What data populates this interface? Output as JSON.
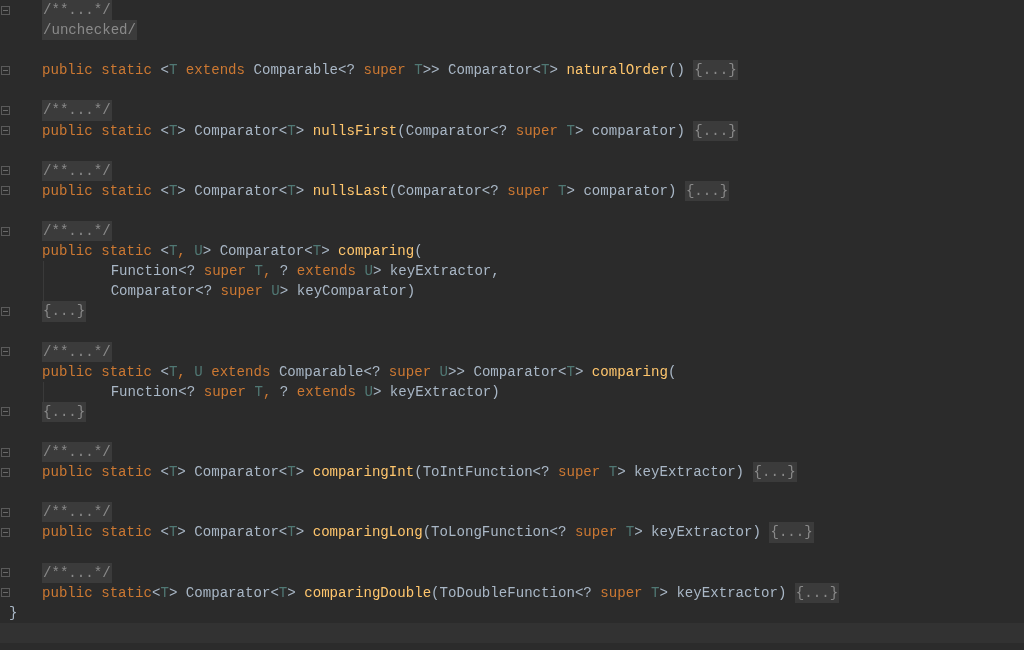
{
  "editor": {
    "lines": [
      {
        "kind": "code",
        "fold_marker": true,
        "tokens": [
          {
            "text": "/**...*/",
            "kind": "folded"
          }
        ]
      },
      {
        "kind": "code",
        "fold_marker": false,
        "tokens": [
          {
            "text": "/unchecked/",
            "kind": "folded"
          }
        ]
      },
      {
        "kind": "blank",
        "fold_marker": false
      },
      {
        "kind": "code",
        "fold_marker": true,
        "tokens": [
          {
            "text": "public static ",
            "kind": "keyword"
          },
          {
            "text": "<",
            "kind": "plain"
          },
          {
            "text": "T",
            "kind": "type_param"
          },
          {
            "text": " extends ",
            "kind": "keyword"
          },
          {
            "text": "Comparable<? ",
            "kind": "plain"
          },
          {
            "text": "super ",
            "kind": "keyword"
          },
          {
            "text": "T",
            "kind": "type_param"
          },
          {
            "text": ">> Comparator<",
            "kind": "plain"
          },
          {
            "text": "T",
            "kind": "type_param"
          },
          {
            "text": "> ",
            "kind": "plain"
          },
          {
            "text": "naturalOrder",
            "kind": "method"
          },
          {
            "text": "()",
            "kind": "plain"
          },
          {
            "text": "{...}",
            "kind": "folded"
          }
        ]
      },
      {
        "kind": "blank",
        "fold_marker": false
      },
      {
        "kind": "code",
        "fold_marker": true,
        "tokens": [
          {
            "text": "/**...*/",
            "kind": "folded"
          }
        ]
      },
      {
        "kind": "code",
        "fold_marker": true,
        "tokens": [
          {
            "text": "public static ",
            "kind": "keyword"
          },
          {
            "text": "<",
            "kind": "plain"
          },
          {
            "text": "T",
            "kind": "type_param"
          },
          {
            "text": "> Comparator<",
            "kind": "plain"
          },
          {
            "text": "T",
            "kind": "type_param"
          },
          {
            "text": "> ",
            "kind": "plain"
          },
          {
            "text": "nullsFirst",
            "kind": "method"
          },
          {
            "text": "(Comparator<? ",
            "kind": "plain"
          },
          {
            "text": "super ",
            "kind": "keyword"
          },
          {
            "text": "T",
            "kind": "type_param"
          },
          {
            "text": "> comparator)",
            "kind": "plain"
          },
          {
            "text": "{...}",
            "kind": "folded"
          }
        ]
      },
      {
        "kind": "blank",
        "fold_marker": false
      },
      {
        "kind": "code",
        "fold_marker": true,
        "tokens": [
          {
            "text": "/**...*/",
            "kind": "folded"
          }
        ]
      },
      {
        "kind": "code",
        "fold_marker": true,
        "tokens": [
          {
            "text": "public static ",
            "kind": "keyword"
          },
          {
            "text": "<",
            "kind": "plain"
          },
          {
            "text": "T",
            "kind": "type_param"
          },
          {
            "text": "> Comparator<",
            "kind": "plain"
          },
          {
            "text": "T",
            "kind": "type_param"
          },
          {
            "text": "> ",
            "kind": "plain"
          },
          {
            "text": "nullsLast",
            "kind": "method"
          },
          {
            "text": "(Comparator<? ",
            "kind": "plain"
          },
          {
            "text": "super ",
            "kind": "keyword"
          },
          {
            "text": "T",
            "kind": "type_param"
          },
          {
            "text": "> comparator)",
            "kind": "plain"
          },
          {
            "text": "{...}",
            "kind": "folded"
          }
        ]
      },
      {
        "kind": "blank",
        "fold_marker": false
      },
      {
        "kind": "code",
        "fold_marker": true,
        "tokens": [
          {
            "text": "/**...*/",
            "kind": "folded"
          }
        ]
      },
      {
        "kind": "code",
        "fold_marker": false,
        "tokens": [
          {
            "text": "public static ",
            "kind": "keyword"
          },
          {
            "text": "<",
            "kind": "plain"
          },
          {
            "text": "T",
            "kind": "type_param"
          },
          {
            "text": ", ",
            "kind": "keyword"
          },
          {
            "text": "U",
            "kind": "type_param"
          },
          {
            "text": "> Comparator<",
            "kind": "plain"
          },
          {
            "text": "T",
            "kind": "type_param"
          },
          {
            "text": "> ",
            "kind": "plain"
          },
          {
            "text": "comparing",
            "kind": "method"
          },
          {
            "text": "(",
            "kind": "plain"
          }
        ]
      },
      {
        "kind": "continuation",
        "fold_marker": false,
        "tokens": [
          {
            "text": "Function<? ",
            "kind": "plain"
          },
          {
            "text": "super ",
            "kind": "keyword"
          },
          {
            "text": "T",
            "kind": "type_param"
          },
          {
            "text": ", ",
            "kind": "keyword"
          },
          {
            "text": "? ",
            "kind": "plain"
          },
          {
            "text": "extends ",
            "kind": "keyword"
          },
          {
            "text": "U",
            "kind": "type_param"
          },
          {
            "text": "> keyExtractor,",
            "kind": "plain"
          }
        ]
      },
      {
        "kind": "continuation",
        "fold_marker": false,
        "tokens": [
          {
            "text": "Comparator<? ",
            "kind": "plain"
          },
          {
            "text": "super ",
            "kind": "keyword"
          },
          {
            "text": "U",
            "kind": "type_param"
          },
          {
            "text": "> keyComparator)",
            "kind": "plain"
          }
        ]
      },
      {
        "kind": "code",
        "fold_marker": true,
        "tokens": [
          {
            "text": "{...}",
            "kind": "folded"
          }
        ]
      },
      {
        "kind": "blank",
        "fold_marker": false
      },
      {
        "kind": "code",
        "fold_marker": true,
        "tokens": [
          {
            "text": "/**...*/",
            "kind": "folded"
          }
        ]
      },
      {
        "kind": "code",
        "fold_marker": false,
        "tokens": [
          {
            "text": "public static ",
            "kind": "keyword"
          },
          {
            "text": "<",
            "kind": "plain"
          },
          {
            "text": "T",
            "kind": "type_param"
          },
          {
            "text": ", ",
            "kind": "keyword"
          },
          {
            "text": "U",
            "kind": "type_param"
          },
          {
            "text": " extends ",
            "kind": "keyword"
          },
          {
            "text": "Comparable<? ",
            "kind": "plain"
          },
          {
            "text": "super ",
            "kind": "keyword"
          },
          {
            "text": "U",
            "kind": "type_param"
          },
          {
            "text": ">> Comparator<",
            "kind": "plain"
          },
          {
            "text": "T",
            "kind": "type_param"
          },
          {
            "text": "> ",
            "kind": "plain"
          },
          {
            "text": "comparing",
            "kind": "method"
          },
          {
            "text": "(",
            "kind": "plain"
          }
        ]
      },
      {
        "kind": "continuation",
        "fold_marker": false,
        "tokens": [
          {
            "text": "Function<? ",
            "kind": "plain"
          },
          {
            "text": "super ",
            "kind": "keyword"
          },
          {
            "text": "T",
            "kind": "type_param"
          },
          {
            "text": ", ",
            "kind": "keyword"
          },
          {
            "text": "? ",
            "kind": "plain"
          },
          {
            "text": "extends ",
            "kind": "keyword"
          },
          {
            "text": "U",
            "kind": "type_param"
          },
          {
            "text": "> keyExtractor)",
            "kind": "plain"
          }
        ]
      },
      {
        "kind": "code",
        "fold_marker": true,
        "tokens": [
          {
            "text": "{...}",
            "kind": "folded"
          }
        ]
      },
      {
        "kind": "blank",
        "fold_marker": false
      },
      {
        "kind": "code",
        "fold_marker": true,
        "tokens": [
          {
            "text": "/**...*/",
            "kind": "folded"
          }
        ]
      },
      {
        "kind": "code",
        "fold_marker": true,
        "tokens": [
          {
            "text": "public static ",
            "kind": "keyword"
          },
          {
            "text": "<",
            "kind": "plain"
          },
          {
            "text": "T",
            "kind": "type_param"
          },
          {
            "text": "> Comparator<",
            "kind": "plain"
          },
          {
            "text": "T",
            "kind": "type_param"
          },
          {
            "text": "> ",
            "kind": "plain"
          },
          {
            "text": "comparingInt",
            "kind": "method"
          },
          {
            "text": "(ToIntFunction<? ",
            "kind": "plain"
          },
          {
            "text": "super ",
            "kind": "keyword"
          },
          {
            "text": "T",
            "kind": "type_param"
          },
          {
            "text": "> keyExtractor)",
            "kind": "plain"
          },
          {
            "text": "{...}",
            "kind": "folded"
          }
        ]
      },
      {
        "kind": "blank",
        "fold_marker": false
      },
      {
        "kind": "code",
        "fold_marker": true,
        "tokens": [
          {
            "text": "/**...*/",
            "kind": "folded"
          }
        ]
      },
      {
        "kind": "code",
        "fold_marker": true,
        "tokens": [
          {
            "text": "public static ",
            "kind": "keyword"
          },
          {
            "text": "<",
            "kind": "plain"
          },
          {
            "text": "T",
            "kind": "type_param"
          },
          {
            "text": "> Comparator<",
            "kind": "plain"
          },
          {
            "text": "T",
            "kind": "type_param"
          },
          {
            "text": "> ",
            "kind": "plain"
          },
          {
            "text": "comparingLong",
            "kind": "method"
          },
          {
            "text": "(ToLongFunction<? ",
            "kind": "plain"
          },
          {
            "text": "super ",
            "kind": "keyword"
          },
          {
            "text": "T",
            "kind": "type_param"
          },
          {
            "text": "> keyExtractor)",
            "kind": "plain"
          },
          {
            "text": "{...}",
            "kind": "folded"
          }
        ]
      },
      {
        "kind": "blank",
        "fold_marker": false
      },
      {
        "kind": "code",
        "fold_marker": true,
        "tokens": [
          {
            "text": "/**...*/",
            "kind": "folded"
          }
        ]
      },
      {
        "kind": "code",
        "fold_marker": true,
        "tokens": [
          {
            "text": "public static",
            "kind": "keyword"
          },
          {
            "text": "<",
            "kind": "plain"
          },
          {
            "text": "T",
            "kind": "type_param"
          },
          {
            "text": "> Comparator<",
            "kind": "plain"
          },
          {
            "text": "T",
            "kind": "type_param"
          },
          {
            "text": "> ",
            "kind": "plain"
          },
          {
            "text": "comparingDouble",
            "kind": "method"
          },
          {
            "text": "(ToDoubleFunction<? ",
            "kind": "plain"
          },
          {
            "text": "super ",
            "kind": "keyword"
          },
          {
            "text": "T",
            "kind": "type_param"
          },
          {
            "text": "> keyExtractor)",
            "kind": "plain"
          },
          {
            "text": "{...}",
            "kind": "folded"
          }
        ]
      },
      {
        "kind": "closing",
        "fold_marker": false,
        "tokens": [
          {
            "text": "}",
            "kind": "plain"
          }
        ]
      },
      {
        "kind": "caret",
        "fold_marker": false
      }
    ]
  }
}
